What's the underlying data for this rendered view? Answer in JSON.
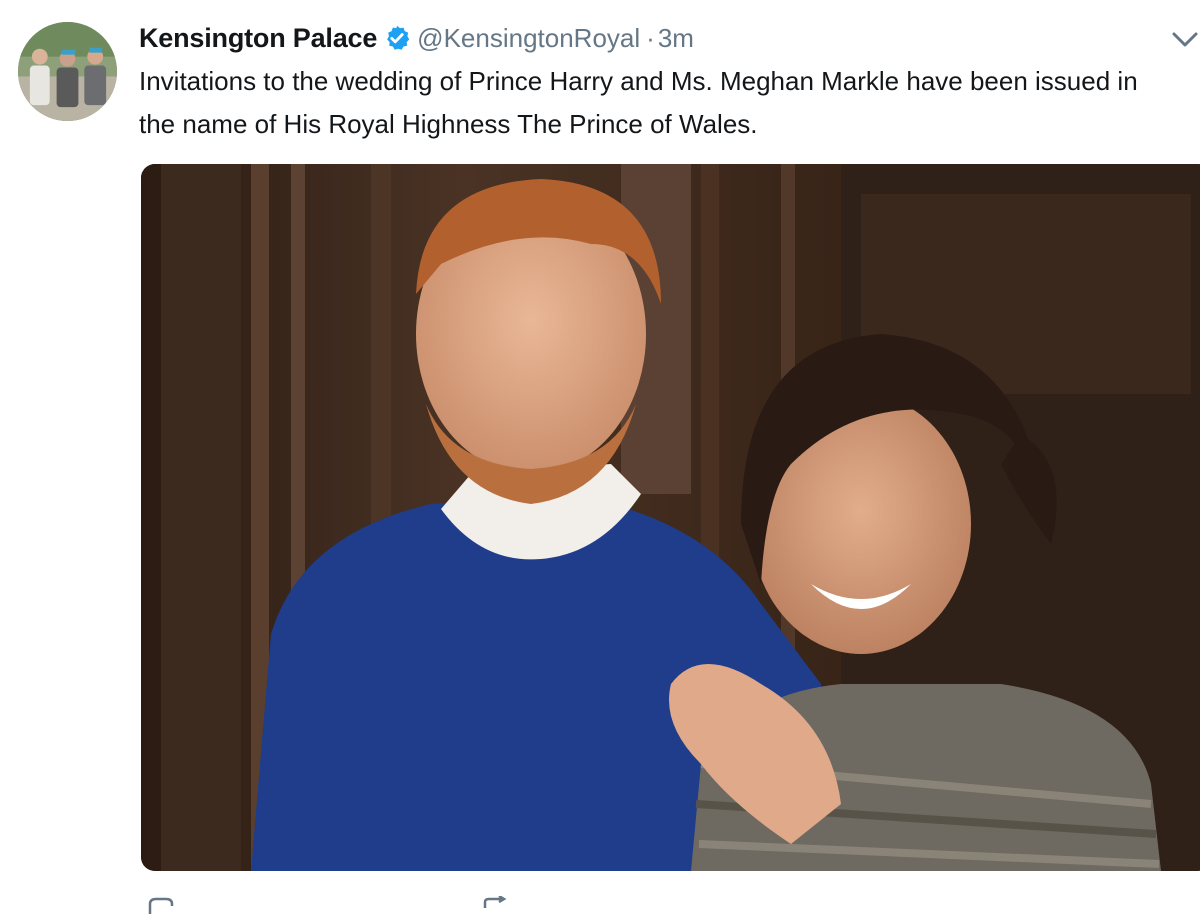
{
  "tweet": {
    "display_name": "Kensington Palace",
    "handle": "@KensingtonRoyal",
    "separator": "·",
    "timestamp": "3m",
    "text": "Invitations to the wedding of Prince Harry and Ms. Meghan Markle have been issued in the name of His Royal Highness The Prince of Wales."
  },
  "icons": {
    "verified": "verified-badge-icon",
    "more": "chevron-down-icon",
    "reply": "reply-icon",
    "retweet": "retweet-icon"
  },
  "colors": {
    "name": "#14171a",
    "secondary_text": "#657786",
    "verified_blue": "#1da1f2",
    "background": "#ffffff"
  }
}
